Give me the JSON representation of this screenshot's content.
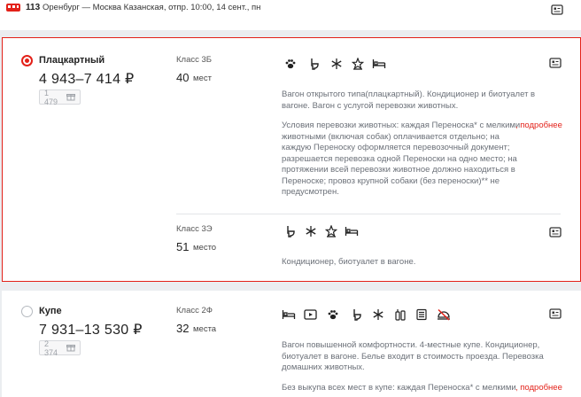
{
  "top_train": {
    "number": "113",
    "description": "Оренбург — Москва Казанская, отпр. 10:00, 14 сент., пн"
  },
  "car1": {
    "type": "Плацкартный",
    "price": "4 943–7 414 ₽",
    "bonus": "1 479",
    "selected": true,
    "subclasses": [
      {
        "class": "Класс 3Б",
        "seats_count": "40",
        "seats_word": "мест",
        "icons": [
          "paw-icon",
          "toilet-icon",
          "snowflake-icon",
          "star-hat-icon",
          "bed-icon"
        ],
        "description": "Вагон открытого типа(плацкартный). Кондиционер и биотуалет в вагоне. Вагон с услугой перевозки животных.",
        "animals_lines": [
          "Условия перевозки животных: каждая Переноска* с мелкими",
          "животными (включая собак) оплачивается отдельно; на",
          "каждую Переноску оформляется перевозочный документ;",
          "разрешается перевозка одной Переноски на одно место; на",
          "протяжении всей перевозки животное должно находиться в",
          "Переноске; провоз крупной собаки (без переноски)** не",
          "предусмотрен."
        ],
        "more_link": ", подробнее"
      },
      {
        "class": "Класс 3Э",
        "seats_count": "51",
        "seats_word": "место",
        "icons": [
          "toilet-icon",
          "snowflake-icon",
          "star-hat-icon",
          "bed-icon"
        ],
        "description": "Кондиционер, биотуалет в вагоне."
      }
    ]
  },
  "car2": {
    "type": "Купе",
    "price": "7 931–13 530 ₽",
    "bonus": "2 374",
    "selected": false,
    "subclass": {
      "class": "Класс 2Ф",
      "seats_count": "32",
      "seats_word": "места",
      "icons": [
        "bed-icon",
        "tv-icon",
        "paw-icon",
        "toilet-icon",
        "snowflake-icon",
        "hygiene-icon",
        "newspaper-icon",
        "no-food-icon"
      ],
      "description": "Вагон повышенной комфортности. 4-местные купе. Кондиционер, биотуалет в вагоне. Белье входит в стоимость проезда. Перевозка домашних животных.",
      "animals_line": "Без выкупа всех мест в купе: каждая Переноска* с мелкими",
      "more_link": ", подробнее"
    }
  },
  "colors": {
    "accent": "#e32119",
    "border_selected": "#e32119",
    "text_grey": "#6b7078"
  }
}
